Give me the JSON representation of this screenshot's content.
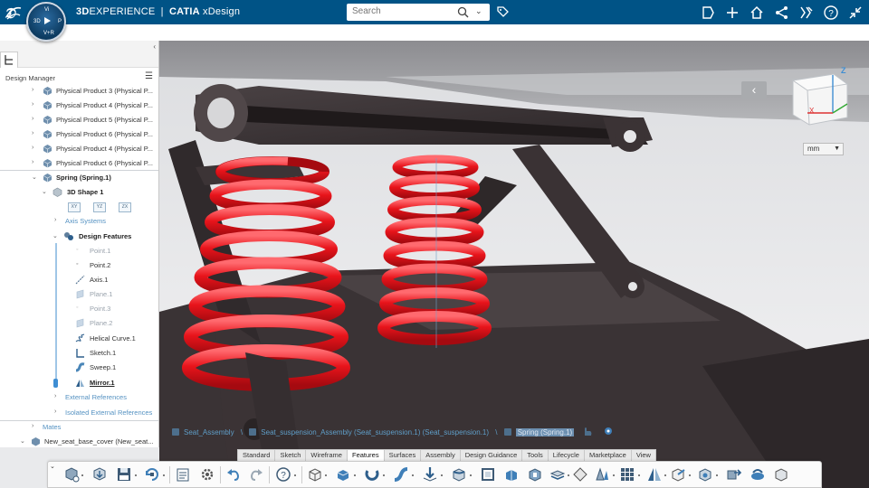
{
  "header": {
    "brand_bold": "3D",
    "brand_rest": "EXPERIENCE",
    "separator": "|",
    "app_name_bold": "CATIA",
    "app_name_rest": "xDesign",
    "search_placeholder": "Search",
    "compass_labels": [
      "3D",
      "V+R",
      "Vi",
      "P"
    ]
  },
  "panel": {
    "title": "Design Manager",
    "tree_top": [
      {
        "label": "Physical Product 3 (Physical P..."
      },
      {
        "label": "Physical Product 4 (Physical P..."
      },
      {
        "label": "Physical Product 5 (Physical P..."
      },
      {
        "label": "Physical Product 6 (Physical P..."
      },
      {
        "label": "Physical Product 4 (Physical P..."
      },
      {
        "label": "Physical Product 6 (Physical P..."
      }
    ],
    "spring_label": "Spring (Spring.1)",
    "shape_label": "3D Shape 1",
    "axes_buttons": [
      "XY",
      "YZ",
      "ZX"
    ],
    "axis_systems": "Axis Systems",
    "design_features": "Design Features",
    "features": [
      {
        "label": "Point.1",
        "state": "dim",
        "icon": "point-icon"
      },
      {
        "label": "Point.2",
        "state": "normal",
        "icon": "point-icon"
      },
      {
        "label": "Axis.1",
        "state": "normal",
        "icon": "axis-icon"
      },
      {
        "label": "Plane.1",
        "state": "dim",
        "icon": "plane-icon"
      },
      {
        "label": "Point.3",
        "state": "dim",
        "icon": "point-icon"
      },
      {
        "label": "Plane.2",
        "state": "dim",
        "icon": "plane-icon"
      },
      {
        "label": "Helical Curve.1",
        "state": "normal",
        "icon": "helix-icon"
      },
      {
        "label": "Sketch.1",
        "state": "normal",
        "icon": "sketch-icon"
      },
      {
        "label": "Sweep.1",
        "state": "normal",
        "icon": "sweep-icon"
      },
      {
        "label": "Mirror.1",
        "state": "bold",
        "icon": "mirror-icon"
      }
    ],
    "external_references": "External References",
    "isolated_external_references": "Isolated External References",
    "mates": "Mates",
    "last_item": "New_seat_base_cover (New_seat..."
  },
  "viewport": {
    "units": "mm"
  },
  "breadcrumb": [
    "Seat_Assembly",
    "Seat_suspension_Assembly (Seat_suspension.1) (Seat_suspension.1)",
    "Spring (Spring.1)"
  ],
  "tabs": [
    "Standard",
    "Sketch",
    "Wireframe",
    "Features",
    "Surfaces",
    "Assembly",
    "Design Guidance",
    "Tools",
    "Lifecycle",
    "Marketplace",
    "View"
  ],
  "active_tab": "Features",
  "colors": {
    "topbar": "#005386",
    "spring": "#e8141b",
    "frame": "#3d3535",
    "accent": "#3f8ed3"
  }
}
